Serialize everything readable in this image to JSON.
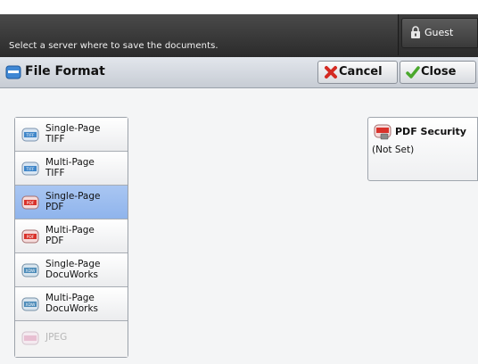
{
  "header": {
    "message": "Select a server where to save the documents.",
    "user_label": "Guest",
    "user_icon": "lock-user-icon"
  },
  "titlebar": {
    "title": "File Format",
    "title_icon": "file-format-icon",
    "cancel_label": "Cancel",
    "cancel_icon": "red-x-icon",
    "close_label": "Close",
    "close_icon": "green-check-icon"
  },
  "formats": {
    "selected": "Single-Page PDF",
    "items": [
      {
        "label": "Single-Page\nTIFF",
        "badge": "TIFF"
      },
      {
        "label": "Multi-Page\nTIFF",
        "badge": "TIFF"
      },
      {
        "label": "Single-Page\nPDF",
        "badge": "PDF"
      },
      {
        "label": "Multi-Page\nPDF",
        "badge": "PDF"
      },
      {
        "label": "Single-Page\nDocuWorks",
        "badge": "XDW"
      },
      {
        "label": "Multi-Page\nDocuWorks",
        "badge": "XDW"
      },
      {
        "label": "JPEG",
        "badge": "JPEG"
      }
    ]
  },
  "pdf_security": {
    "title": "PDF Security",
    "value": "(Not Set)",
    "icon": "pdf-security-icon"
  },
  "colors": {
    "selected_bg": "#8fb4ec",
    "pdf_badge": "#d9322b",
    "tiff_badge": "#3f86c9",
    "xdw_badge": "#4a8ab8"
  }
}
